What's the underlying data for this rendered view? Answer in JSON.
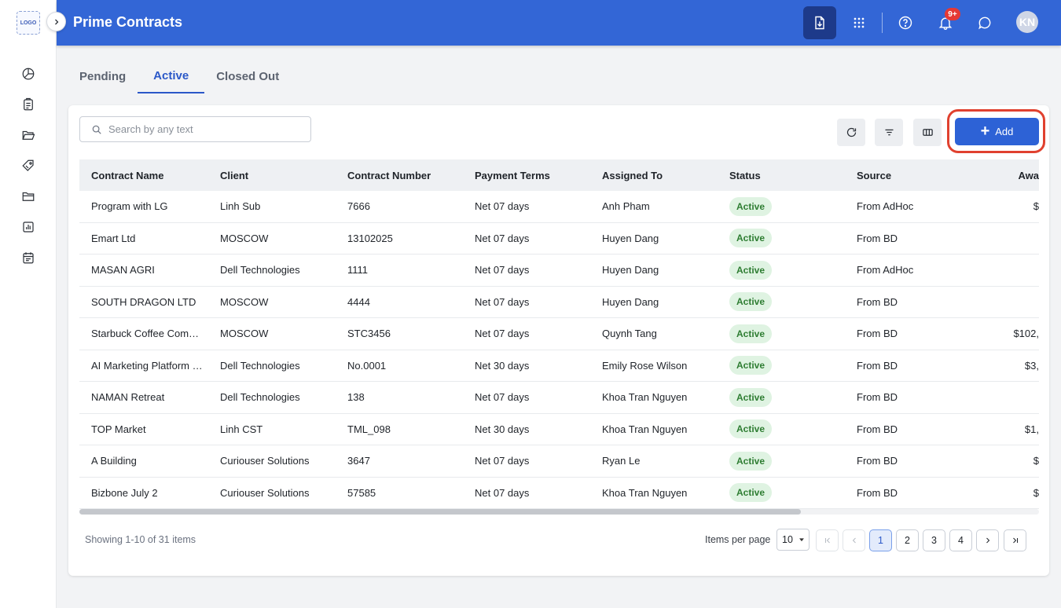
{
  "rail": {
    "logo_text": "LOGO",
    "icons": [
      "pie-chart-icon",
      "clipboard-icon",
      "folder-open-icon",
      "tag-icon",
      "folder-icon",
      "bar-chart-icon",
      "calendar-icon"
    ]
  },
  "header": {
    "title": "Prime Contracts",
    "notification_count": "9+",
    "avatar_initials": "KN",
    "accent_color": "#3366d6"
  },
  "tabs": [
    {
      "label": "Pending",
      "active": false
    },
    {
      "label": "Active",
      "active": true
    },
    {
      "label": "Closed Out",
      "active": false
    }
  ],
  "toolbar": {
    "search_placeholder": "Search by any text",
    "add_label": "Add"
  },
  "table": {
    "columns": [
      "Contract Name",
      "Client",
      "Contract Number",
      "Payment Terms",
      "Assigned To",
      "Status",
      "Source",
      "Awa"
    ],
    "rows": [
      {
        "name": "Program with LG",
        "client": "Linh Sub",
        "number": "7666",
        "terms": "Net 07 days",
        "assigned": "Anh Pham",
        "status": "Active",
        "source": "From AdHoc",
        "award": "$"
      },
      {
        "name": "Emart Ltd",
        "client": "MOSCOW",
        "number": "13102025",
        "terms": "Net 07 days",
        "assigned": "Huyen Dang",
        "status": "Active",
        "source": "From BD",
        "award": ""
      },
      {
        "name": "MASAN AGRI",
        "client": "Dell Technologies",
        "number": "1111",
        "terms": "Net 07 days",
        "assigned": "Huyen Dang",
        "status": "Active",
        "source": "From AdHoc",
        "award": ""
      },
      {
        "name": "SOUTH DRAGON LTD",
        "client": "MOSCOW",
        "number": "4444",
        "terms": "Net 07 days",
        "assigned": "Huyen Dang",
        "status": "Active",
        "source": "From BD",
        "award": ""
      },
      {
        "name": "Starbuck Coffee Com…",
        "client": "MOSCOW",
        "number": "STC3456",
        "terms": "Net 07 days",
        "assigned": "Quynh Tang",
        "status": "Active",
        "source": "From BD",
        "award": "$102,"
      },
      {
        "name": "AI Marketing Platform …",
        "client": "Dell Technologies",
        "number": "No.0001",
        "terms": "Net 30 days",
        "assigned": "Emily Rose Wilson",
        "status": "Active",
        "source": "From BD",
        "award": "$3,"
      },
      {
        "name": "NAMAN Retreat",
        "client": "Dell Technologies",
        "number": "138",
        "terms": "Net 07 days",
        "assigned": "Khoa Tran Nguyen",
        "status": "Active",
        "source": "From BD",
        "award": ""
      },
      {
        "name": "TOP Market",
        "client": "Linh CST",
        "number": "TML_098",
        "terms": "Net 30 days",
        "assigned": "Khoa Tran Nguyen",
        "status": "Active",
        "source": "From BD",
        "award": "$1,"
      },
      {
        "name": "A Building",
        "client": "Curiouser Solutions",
        "number": "3647",
        "terms": "Net 07 days",
        "assigned": "Ryan Le",
        "status": "Active",
        "source": "From BD",
        "award": "$"
      },
      {
        "name": "Bizbone July 2",
        "client": "Curiouser Solutions",
        "number": "57585",
        "terms": "Net 07 days",
        "assigned": "Khoa Tran Nguyen",
        "status": "Active",
        "source": "From BD",
        "award": "$"
      }
    ]
  },
  "footer": {
    "showing_text": "Showing 1-10 of 31 items",
    "items_per_page_label": "Items per page",
    "items_per_page_value": "10",
    "pages": [
      "1",
      "2",
      "3",
      "4"
    ],
    "current_page": "1"
  }
}
